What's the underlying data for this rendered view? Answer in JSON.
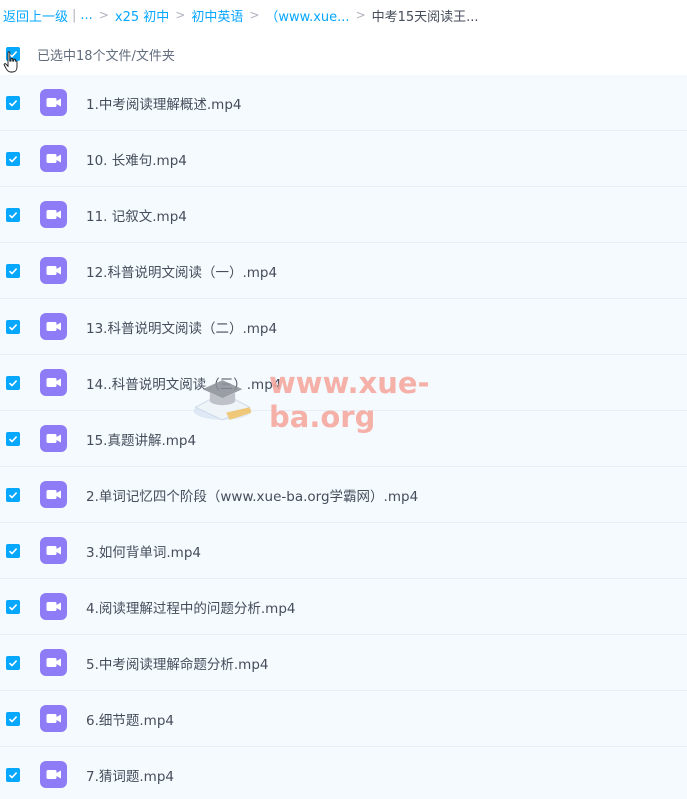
{
  "breadcrumb": {
    "back": "返回上一级",
    "ellipsis": "...",
    "items": [
      "x25 初中",
      "初中英语",
      "（www.xue...",
      "中考15天阅读王..."
    ]
  },
  "selection": {
    "label": "已选中18个文件/文件夹"
  },
  "files": [
    "1.中考阅读理解概述.mp4",
    "10. 长难句.mp4",
    "11. 记叙文.mp4",
    "12.科普说明文阅读（一）.mp4",
    "13.科普说明文阅读（二）.mp4",
    "14..科普说明文阅读（三）.mp4",
    "15.真题讲解.mp4",
    "2.单词记忆四个阶段（www.xue-ba.org学霸网）.mp4",
    "3.如何背单词.mp4",
    "4.阅读理解过程中的问题分析.mp4",
    "5.中考阅读理解命题分析.mp4",
    "6.细节题.mp4",
    "7.猜词题.mp4"
  ],
  "watermark": "www.xue-ba.org",
  "colors": {
    "accent": "#06a7ff",
    "video_icon": "#8e7cf6",
    "row_bg": "#f5faff"
  }
}
